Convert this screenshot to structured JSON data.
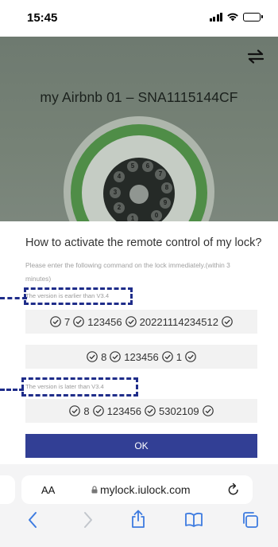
{
  "status_bar": {
    "time": "15:45"
  },
  "hero": {
    "device_title": "my Airbnb 01 – SNA1115144CF"
  },
  "keypad": {
    "keys": [
      "1",
      "2",
      "3",
      "4",
      "5",
      "6",
      "7",
      "8",
      "9",
      "0"
    ]
  },
  "content": {
    "heading": "How to activate the remote control of my lock?",
    "instruction": "Please enter the following command on the lock immediately.(within 3 minutes)",
    "section_old": {
      "label": "The version is earlier than V3.4",
      "commands": [
        [
          "7",
          "123456",
          "20221114234512"
        ],
        [
          "8",
          "123456",
          "1"
        ]
      ]
    },
    "section_new": {
      "label": "The version is later than V3.4",
      "commands": [
        [
          "8",
          "123456",
          "5302109"
        ]
      ]
    },
    "ok_button": "OK"
  },
  "browser": {
    "text_size_label": "AA",
    "url": "mylock.iulock.com"
  },
  "colors": {
    "primary_button": "#323f95",
    "annotation": "#1f2d8a",
    "ring_green": "#4f8d47"
  },
  "icons": [
    "signal-icon",
    "wifi-icon",
    "battery-icon",
    "switch-arrows-icon",
    "check-circle-icon",
    "lock-icon",
    "reload-icon",
    "back-icon",
    "forward-icon",
    "share-icon",
    "bookmarks-icon",
    "tabs-icon"
  ]
}
